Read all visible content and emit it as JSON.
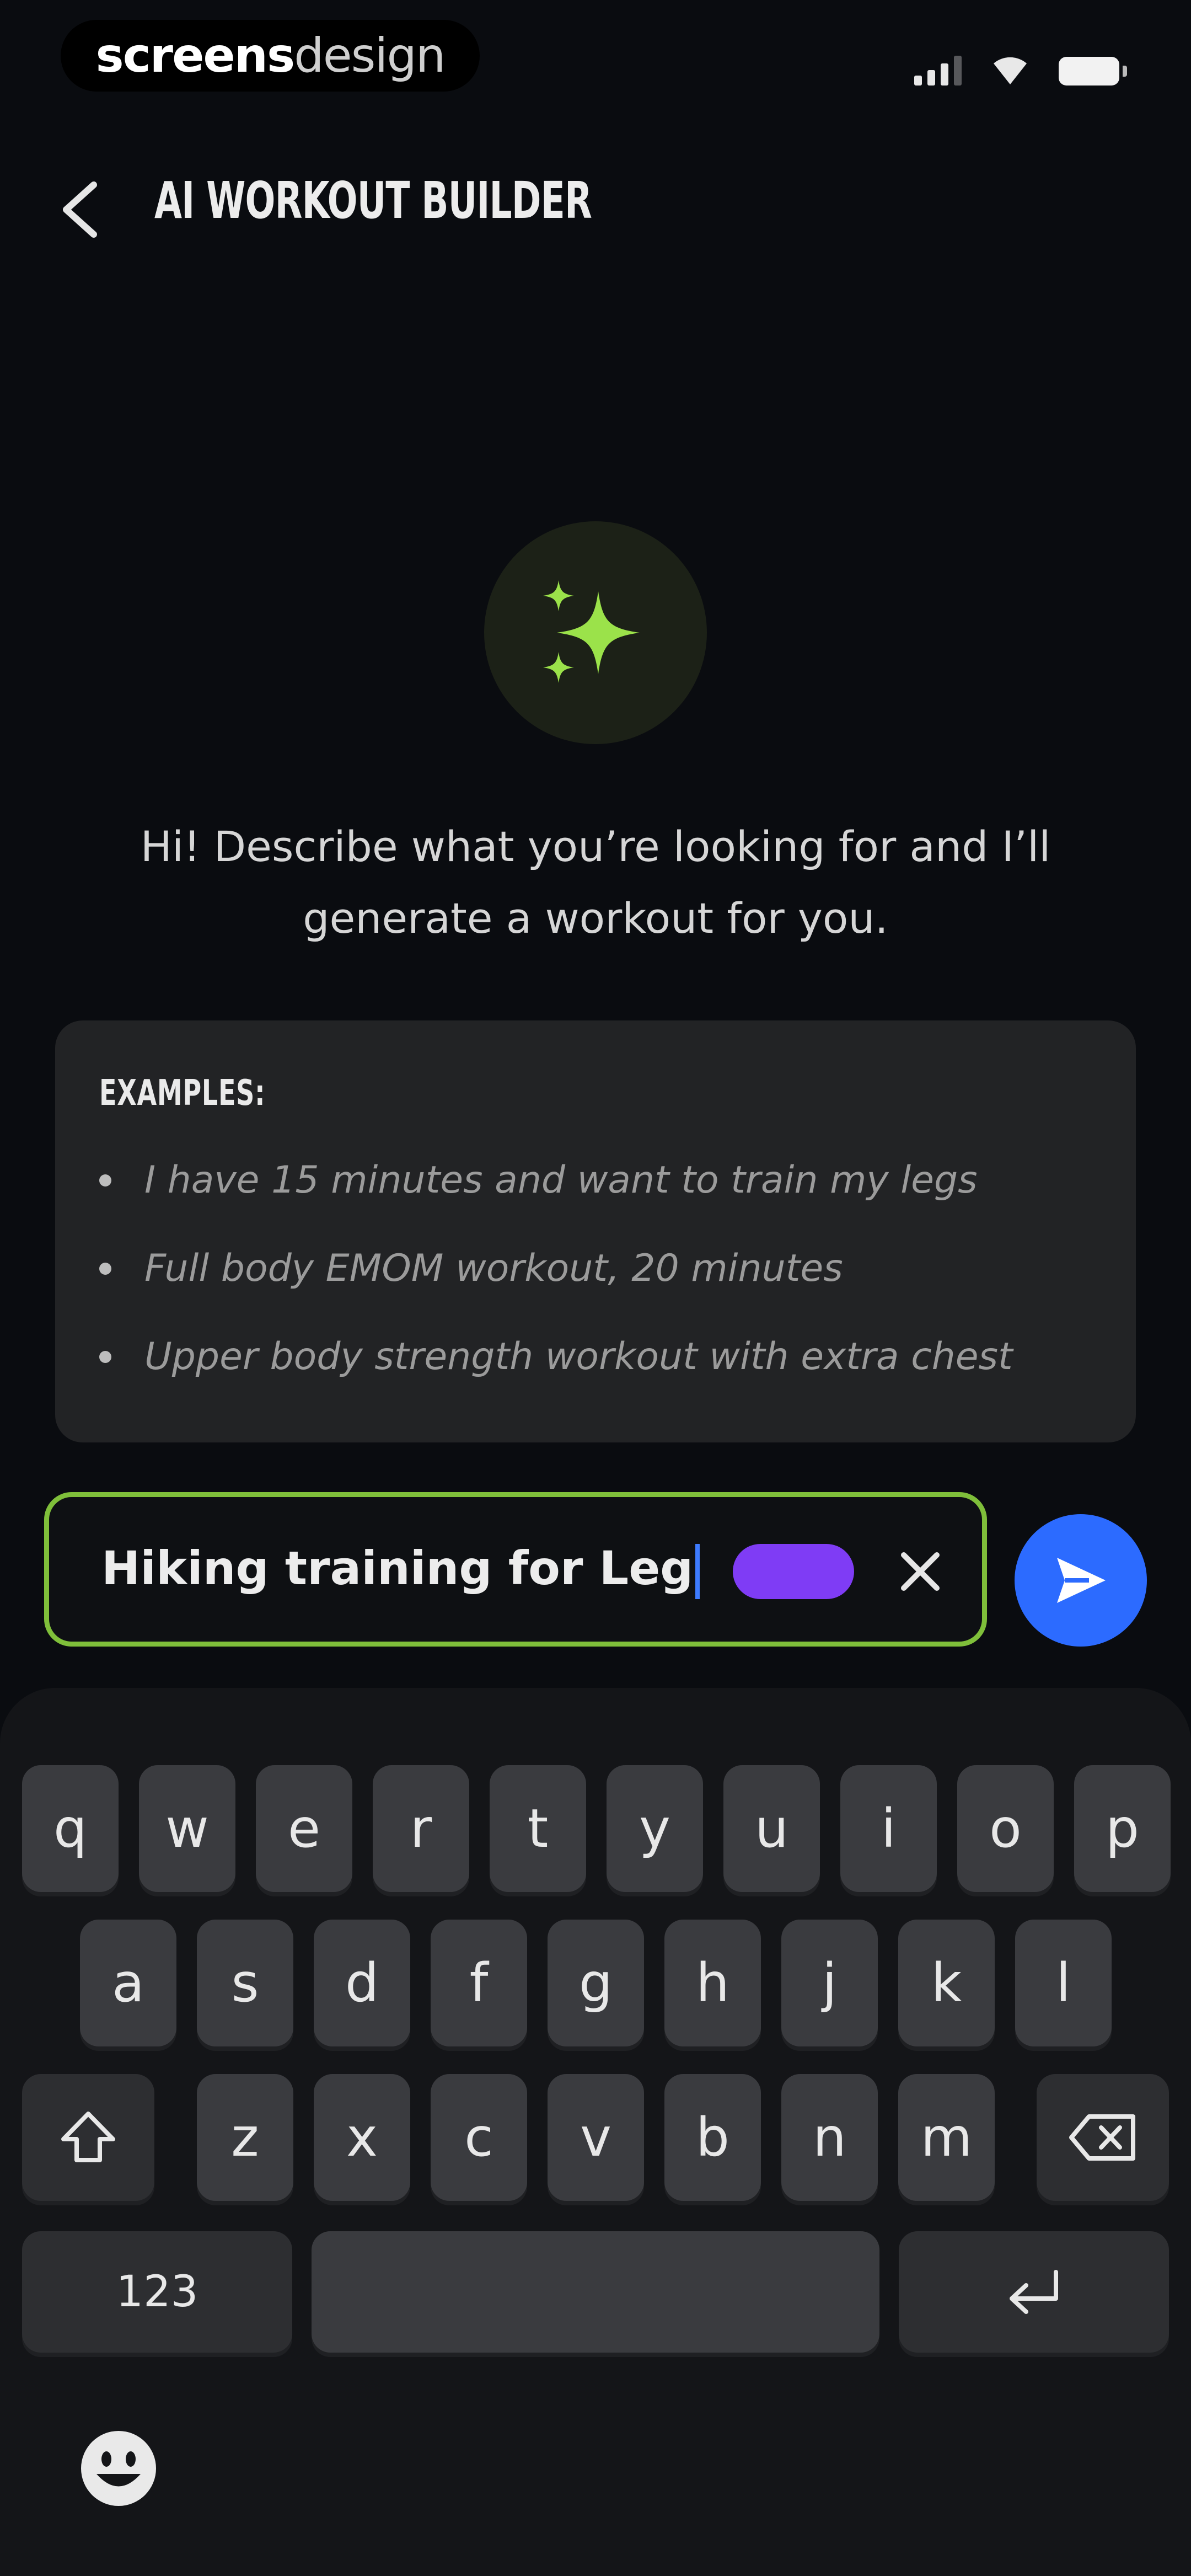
{
  "status_bar": {
    "brand_bold": "screens",
    "brand_light": "design"
  },
  "header": {
    "title": "AI WORKOUT BUILDER",
    "back_icon": "chevron-left-icon"
  },
  "hero": {
    "icon": "sparkles-icon",
    "accent_color": "#9be24a",
    "intro_line1": "Hi! Describe what you’re looking for and I’ll",
    "intro_line2": "generate a workout for you."
  },
  "examples": {
    "title": "EXAMPLES:",
    "items": [
      "I have 15 minutes and want to train my legs",
      "Full body EMOM workout, 20 minutes",
      "Upper body strength workout with extra chest"
    ]
  },
  "input": {
    "value": "Hiking training for Leg",
    "border_color": "#7fbf3a",
    "clear_icon": "close-icon"
  },
  "send_button": {
    "icon": "send-icon",
    "color": "#2c6bff"
  },
  "keyboard": {
    "row1": [
      "q",
      "w",
      "e",
      "r",
      "t",
      "y",
      "u",
      "i",
      "o",
      "p"
    ],
    "row2": [
      "a",
      "s",
      "d",
      "f",
      "g",
      "h",
      "j",
      "k",
      "l"
    ],
    "row3": [
      "z",
      "x",
      "c",
      "v",
      "b",
      "n",
      "m"
    ],
    "numbers_key": "123",
    "shift_icon": "shift-icon",
    "backspace_icon": "backspace-icon",
    "return_icon": "return-icon",
    "emoji_icon": "emoji-icon"
  }
}
